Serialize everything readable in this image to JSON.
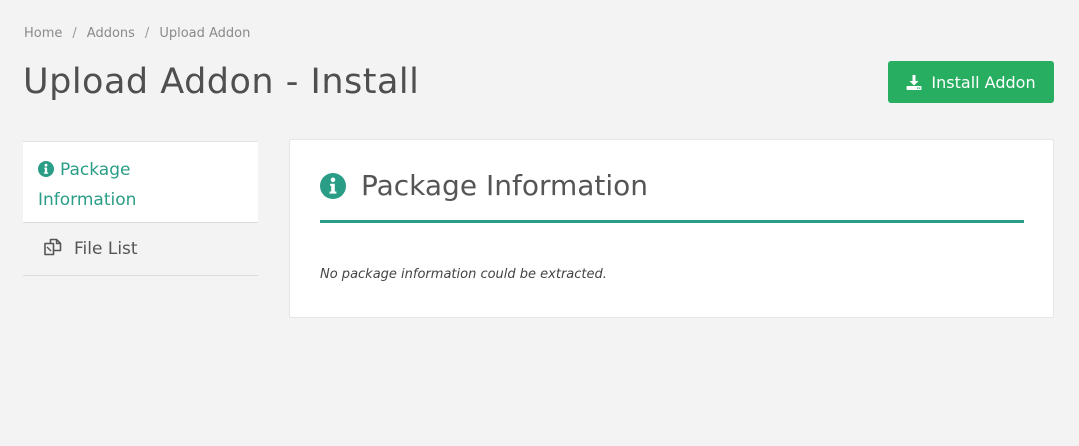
{
  "breadcrumb": {
    "items": [
      "Home",
      "Addons",
      "Upload Addon"
    ],
    "separator": "/"
  },
  "page": {
    "title": "Upload Addon - Install"
  },
  "toolbar": {
    "install_label": "Install Addon",
    "install_icon": "download-icon",
    "install_color": "#27ae60"
  },
  "sidebar": {
    "items": [
      {
        "label_line1": "Package",
        "label_line2": "Information",
        "icon": "info-circle-icon",
        "active": true
      },
      {
        "label": "File List",
        "icon": "copy-files-icon",
        "active": false
      }
    ],
    "active_color": "#2a9d87"
  },
  "panel": {
    "title": "Package Information",
    "icon": "info-circle-icon",
    "note": "No package information could be extracted.",
    "accent_color": "#2a9d87"
  }
}
